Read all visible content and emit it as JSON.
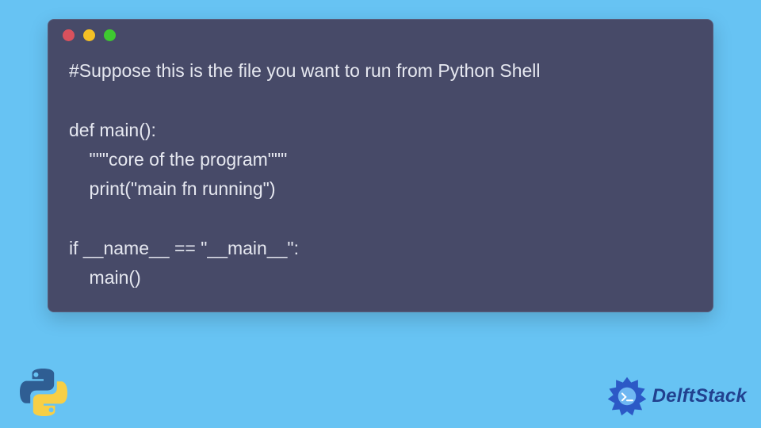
{
  "code": {
    "lines": [
      "#Suppose this is the file you want to run from Python Shell",
      "",
      "def main():",
      "    \"\"\"core of the program\"\"\"",
      "    print(\"main fn running\")",
      "",
      "if __name__ == \"__main__\":",
      "    main()"
    ]
  },
  "brand": {
    "name": "DelftStack"
  },
  "colors": {
    "background": "#67c3f3",
    "window": "#474a68",
    "text": "#e6e8f0",
    "dot_red": "#d9515d",
    "dot_yellow": "#f4c025",
    "dot_green": "#3ec930",
    "brand_blue": "#21418f"
  }
}
